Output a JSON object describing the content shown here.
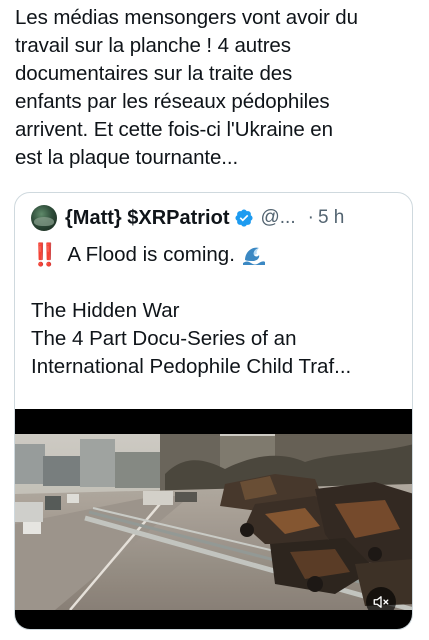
{
  "post": {
    "text": "Les médias mensongers vont avoir du\ntravail sur la planche ! 4 autres\ndocumentaires sur la traite des\nenfants par les réseaux pédophiles\narrivent. Et cette fois-ci l'Ukraine en\nest la plaque tournante..."
  },
  "quote": {
    "display_name": "{Matt} $XRPatriot",
    "handle": "@...",
    "separator": "·",
    "time": "5 h",
    "verified_color": "#1d9bf0",
    "emphasis_mark": "‼️",
    "flood_text": "A Flood is coming.",
    "line_title": "The Hidden War",
    "line_series": "The 4 Part Docu-Series of an",
    "line_truncated": "International Pedophile Child Traf..."
  },
  "media": {
    "type": "video",
    "mute_icon": "volume-muted-icon"
  }
}
